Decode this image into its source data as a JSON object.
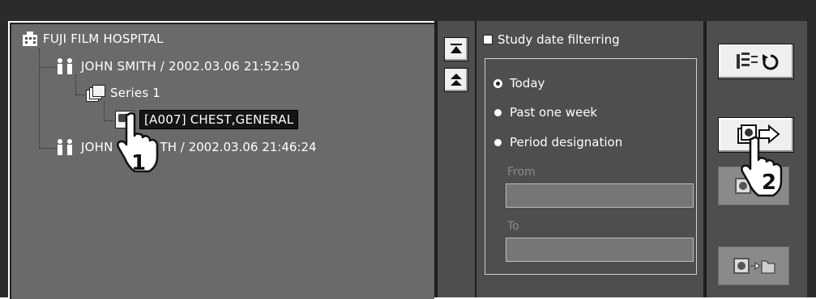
{
  "tree": {
    "hospital": "FUJI FILM HOSPITAL",
    "patient1": "JOHN SMITH / 2002.03.06  21:52:50",
    "series": "Series 1",
    "image": "[A007] CHEST,GENERAL",
    "patient2_left": "JOHN",
    "patient2_right": "TH / 2002.03.06  21:46:24"
  },
  "callouts": {
    "step1": "1",
    "step2": "2"
  },
  "filter": {
    "checkbox_label": "Study date filterring",
    "options": [
      "Today",
      "Past one week",
      "Period designation"
    ],
    "selected": "Today",
    "from_label": "From",
    "to_label": "To",
    "from_value": "",
    "to_value": ""
  },
  "icons": {
    "hospital": "hospital-icon",
    "patient": "patient-icon",
    "series": "series-icon",
    "image": "image-icon",
    "nav_top": "jump-to-top-icon",
    "nav_up": "page-up-icon",
    "refresh": "refresh-list-icon",
    "transfer": "transfer-image-icon",
    "save": "save-to-folder-icon"
  },
  "colors": {
    "panel": "#6a6a6a",
    "dark_panel": "#4e4e4e",
    "frame": "#2b2b2b",
    "selection": "#151515"
  }
}
